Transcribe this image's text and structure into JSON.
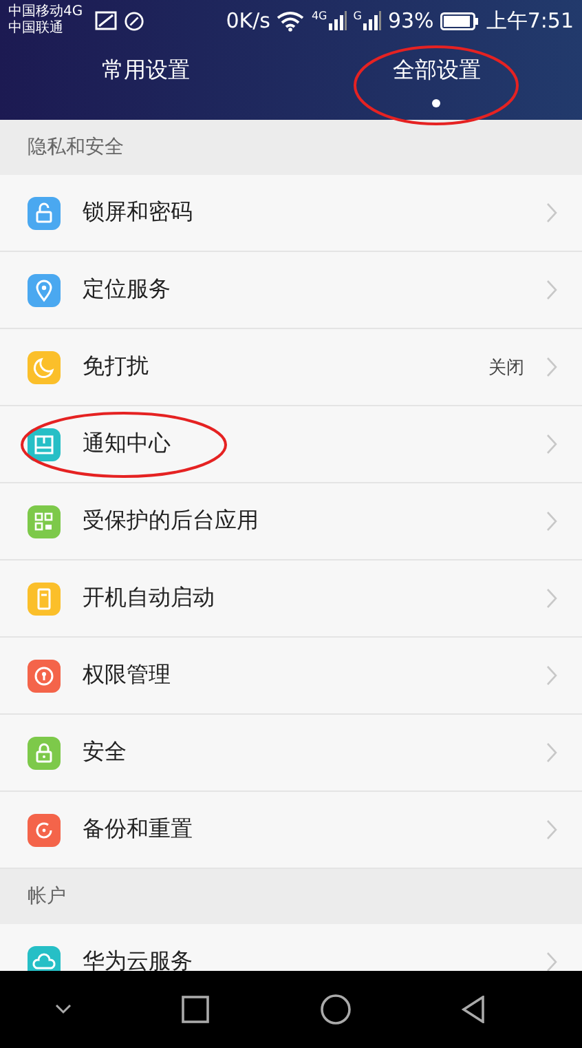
{
  "status_bar": {
    "carriers": [
      "中国移动4G",
      "中国联通"
    ],
    "speed": "0K/s",
    "network_labels": [
      "4G",
      "G"
    ],
    "battery_percent": "93%",
    "time": "上午7:51"
  },
  "tabs": [
    {
      "label": "常用设置",
      "selected": false,
      "annotated": false
    },
    {
      "label": "全部设置",
      "selected": true,
      "annotated": true
    }
  ],
  "sections": [
    {
      "title": "隐私和安全",
      "items": [
        {
          "label": "锁屏和密码",
          "color": "#4aa8f0",
          "annotated": false
        },
        {
          "label": "定位服务",
          "color": "#4aa8f0",
          "annotated": false
        },
        {
          "label": "免打扰",
          "color": "#fbbf2a",
          "value": "关闭",
          "annotated": false
        },
        {
          "label": "通知中心",
          "color": "#26bfc6",
          "annotated": true
        },
        {
          "label": "受保护的后台应用",
          "color": "#7dc94a",
          "annotated": false
        },
        {
          "label": "开机自动启动",
          "color": "#fbbf2a",
          "annotated": false
        },
        {
          "label": "权限管理",
          "color": "#f4644a",
          "annotated": false
        },
        {
          "label": "安全",
          "color": "#7dc94a",
          "annotated": false
        },
        {
          "label": "备份和重置",
          "color": "#f4644a",
          "annotated": false
        }
      ]
    },
    {
      "title": "帐户",
      "items": [
        {
          "label": "华为云服务",
          "color": "#26bfc6",
          "annotated": false
        }
      ]
    }
  ]
}
